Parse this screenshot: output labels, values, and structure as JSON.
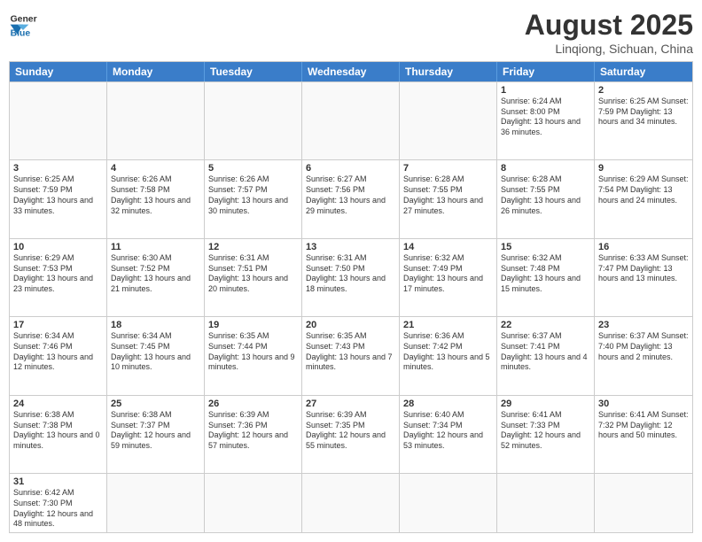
{
  "header": {
    "logo_general": "General",
    "logo_blue": "Blue",
    "month_title": "August 2025",
    "subtitle": "Linqiong, Sichuan, China"
  },
  "days_of_week": [
    "Sunday",
    "Monday",
    "Tuesday",
    "Wednesday",
    "Thursday",
    "Friday",
    "Saturday"
  ],
  "rows": [
    [
      {
        "day": "",
        "info": ""
      },
      {
        "day": "",
        "info": ""
      },
      {
        "day": "",
        "info": ""
      },
      {
        "day": "",
        "info": ""
      },
      {
        "day": "",
        "info": ""
      },
      {
        "day": "1",
        "info": "Sunrise: 6:24 AM\nSunset: 8:00 PM\nDaylight: 13 hours and 36 minutes."
      },
      {
        "day": "2",
        "info": "Sunrise: 6:25 AM\nSunset: 7:59 PM\nDaylight: 13 hours and 34 minutes."
      }
    ],
    [
      {
        "day": "3",
        "info": "Sunrise: 6:25 AM\nSunset: 7:59 PM\nDaylight: 13 hours and 33 minutes."
      },
      {
        "day": "4",
        "info": "Sunrise: 6:26 AM\nSunset: 7:58 PM\nDaylight: 13 hours and 32 minutes."
      },
      {
        "day": "5",
        "info": "Sunrise: 6:26 AM\nSunset: 7:57 PM\nDaylight: 13 hours and 30 minutes."
      },
      {
        "day": "6",
        "info": "Sunrise: 6:27 AM\nSunset: 7:56 PM\nDaylight: 13 hours and 29 minutes."
      },
      {
        "day": "7",
        "info": "Sunrise: 6:28 AM\nSunset: 7:55 PM\nDaylight: 13 hours and 27 minutes."
      },
      {
        "day": "8",
        "info": "Sunrise: 6:28 AM\nSunset: 7:55 PM\nDaylight: 13 hours and 26 minutes."
      },
      {
        "day": "9",
        "info": "Sunrise: 6:29 AM\nSunset: 7:54 PM\nDaylight: 13 hours and 24 minutes."
      }
    ],
    [
      {
        "day": "10",
        "info": "Sunrise: 6:29 AM\nSunset: 7:53 PM\nDaylight: 13 hours and 23 minutes."
      },
      {
        "day": "11",
        "info": "Sunrise: 6:30 AM\nSunset: 7:52 PM\nDaylight: 13 hours and 21 minutes."
      },
      {
        "day": "12",
        "info": "Sunrise: 6:31 AM\nSunset: 7:51 PM\nDaylight: 13 hours and 20 minutes."
      },
      {
        "day": "13",
        "info": "Sunrise: 6:31 AM\nSunset: 7:50 PM\nDaylight: 13 hours and 18 minutes."
      },
      {
        "day": "14",
        "info": "Sunrise: 6:32 AM\nSunset: 7:49 PM\nDaylight: 13 hours and 17 minutes."
      },
      {
        "day": "15",
        "info": "Sunrise: 6:32 AM\nSunset: 7:48 PM\nDaylight: 13 hours and 15 minutes."
      },
      {
        "day": "16",
        "info": "Sunrise: 6:33 AM\nSunset: 7:47 PM\nDaylight: 13 hours and 13 minutes."
      }
    ],
    [
      {
        "day": "17",
        "info": "Sunrise: 6:34 AM\nSunset: 7:46 PM\nDaylight: 13 hours and 12 minutes."
      },
      {
        "day": "18",
        "info": "Sunrise: 6:34 AM\nSunset: 7:45 PM\nDaylight: 13 hours and 10 minutes."
      },
      {
        "day": "19",
        "info": "Sunrise: 6:35 AM\nSunset: 7:44 PM\nDaylight: 13 hours and 9 minutes."
      },
      {
        "day": "20",
        "info": "Sunrise: 6:35 AM\nSunset: 7:43 PM\nDaylight: 13 hours and 7 minutes."
      },
      {
        "day": "21",
        "info": "Sunrise: 6:36 AM\nSunset: 7:42 PM\nDaylight: 13 hours and 5 minutes."
      },
      {
        "day": "22",
        "info": "Sunrise: 6:37 AM\nSunset: 7:41 PM\nDaylight: 13 hours and 4 minutes."
      },
      {
        "day": "23",
        "info": "Sunrise: 6:37 AM\nSunset: 7:40 PM\nDaylight: 13 hours and 2 minutes."
      }
    ],
    [
      {
        "day": "24",
        "info": "Sunrise: 6:38 AM\nSunset: 7:38 PM\nDaylight: 13 hours and 0 minutes."
      },
      {
        "day": "25",
        "info": "Sunrise: 6:38 AM\nSunset: 7:37 PM\nDaylight: 12 hours and 59 minutes."
      },
      {
        "day": "26",
        "info": "Sunrise: 6:39 AM\nSunset: 7:36 PM\nDaylight: 12 hours and 57 minutes."
      },
      {
        "day": "27",
        "info": "Sunrise: 6:39 AM\nSunset: 7:35 PM\nDaylight: 12 hours and 55 minutes."
      },
      {
        "day": "28",
        "info": "Sunrise: 6:40 AM\nSunset: 7:34 PM\nDaylight: 12 hours and 53 minutes."
      },
      {
        "day": "29",
        "info": "Sunrise: 6:41 AM\nSunset: 7:33 PM\nDaylight: 12 hours and 52 minutes."
      },
      {
        "day": "30",
        "info": "Sunrise: 6:41 AM\nSunset: 7:32 PM\nDaylight: 12 hours and 50 minutes."
      }
    ],
    [
      {
        "day": "31",
        "info": "Sunrise: 6:42 AM\nSunset: 7:30 PM\nDaylight: 12 hours and 48 minutes."
      },
      {
        "day": "",
        "info": ""
      },
      {
        "day": "",
        "info": ""
      },
      {
        "day": "",
        "info": ""
      },
      {
        "day": "",
        "info": ""
      },
      {
        "day": "",
        "info": ""
      },
      {
        "day": "",
        "info": ""
      }
    ]
  ]
}
